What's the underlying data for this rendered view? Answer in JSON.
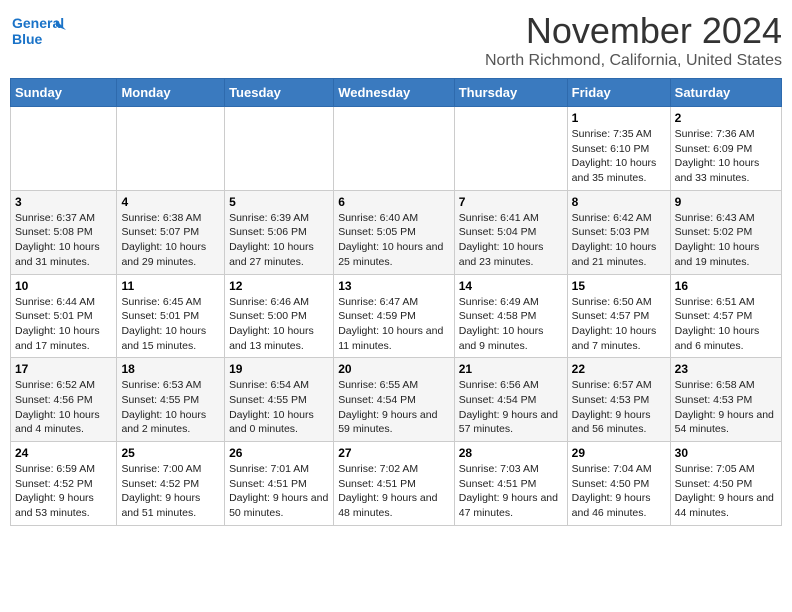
{
  "header": {
    "logo_line1": "General",
    "logo_line2": "Blue",
    "month": "November 2024",
    "location": "North Richmond, California, United States"
  },
  "weekdays": [
    "Sunday",
    "Monday",
    "Tuesday",
    "Wednesday",
    "Thursday",
    "Friday",
    "Saturday"
  ],
  "weeks": [
    [
      {
        "day": "",
        "info": ""
      },
      {
        "day": "",
        "info": ""
      },
      {
        "day": "",
        "info": ""
      },
      {
        "day": "",
        "info": ""
      },
      {
        "day": "",
        "info": ""
      },
      {
        "day": "1",
        "info": "Sunrise: 7:35 AM\nSunset: 6:10 PM\nDaylight: 10 hours and 35 minutes."
      },
      {
        "day": "2",
        "info": "Sunrise: 7:36 AM\nSunset: 6:09 PM\nDaylight: 10 hours and 33 minutes."
      }
    ],
    [
      {
        "day": "3",
        "info": "Sunrise: 6:37 AM\nSunset: 5:08 PM\nDaylight: 10 hours and 31 minutes."
      },
      {
        "day": "4",
        "info": "Sunrise: 6:38 AM\nSunset: 5:07 PM\nDaylight: 10 hours and 29 minutes."
      },
      {
        "day": "5",
        "info": "Sunrise: 6:39 AM\nSunset: 5:06 PM\nDaylight: 10 hours and 27 minutes."
      },
      {
        "day": "6",
        "info": "Sunrise: 6:40 AM\nSunset: 5:05 PM\nDaylight: 10 hours and 25 minutes."
      },
      {
        "day": "7",
        "info": "Sunrise: 6:41 AM\nSunset: 5:04 PM\nDaylight: 10 hours and 23 minutes."
      },
      {
        "day": "8",
        "info": "Sunrise: 6:42 AM\nSunset: 5:03 PM\nDaylight: 10 hours and 21 minutes."
      },
      {
        "day": "9",
        "info": "Sunrise: 6:43 AM\nSunset: 5:02 PM\nDaylight: 10 hours and 19 minutes."
      }
    ],
    [
      {
        "day": "10",
        "info": "Sunrise: 6:44 AM\nSunset: 5:01 PM\nDaylight: 10 hours and 17 minutes."
      },
      {
        "day": "11",
        "info": "Sunrise: 6:45 AM\nSunset: 5:01 PM\nDaylight: 10 hours and 15 minutes."
      },
      {
        "day": "12",
        "info": "Sunrise: 6:46 AM\nSunset: 5:00 PM\nDaylight: 10 hours and 13 minutes."
      },
      {
        "day": "13",
        "info": "Sunrise: 6:47 AM\nSunset: 4:59 PM\nDaylight: 10 hours and 11 minutes."
      },
      {
        "day": "14",
        "info": "Sunrise: 6:49 AM\nSunset: 4:58 PM\nDaylight: 10 hours and 9 minutes."
      },
      {
        "day": "15",
        "info": "Sunrise: 6:50 AM\nSunset: 4:57 PM\nDaylight: 10 hours and 7 minutes."
      },
      {
        "day": "16",
        "info": "Sunrise: 6:51 AM\nSunset: 4:57 PM\nDaylight: 10 hours and 6 minutes."
      }
    ],
    [
      {
        "day": "17",
        "info": "Sunrise: 6:52 AM\nSunset: 4:56 PM\nDaylight: 10 hours and 4 minutes."
      },
      {
        "day": "18",
        "info": "Sunrise: 6:53 AM\nSunset: 4:55 PM\nDaylight: 10 hours and 2 minutes."
      },
      {
        "day": "19",
        "info": "Sunrise: 6:54 AM\nSunset: 4:55 PM\nDaylight: 10 hours and 0 minutes."
      },
      {
        "day": "20",
        "info": "Sunrise: 6:55 AM\nSunset: 4:54 PM\nDaylight: 9 hours and 59 minutes."
      },
      {
        "day": "21",
        "info": "Sunrise: 6:56 AM\nSunset: 4:54 PM\nDaylight: 9 hours and 57 minutes."
      },
      {
        "day": "22",
        "info": "Sunrise: 6:57 AM\nSunset: 4:53 PM\nDaylight: 9 hours and 56 minutes."
      },
      {
        "day": "23",
        "info": "Sunrise: 6:58 AM\nSunset: 4:53 PM\nDaylight: 9 hours and 54 minutes."
      }
    ],
    [
      {
        "day": "24",
        "info": "Sunrise: 6:59 AM\nSunset: 4:52 PM\nDaylight: 9 hours and 53 minutes."
      },
      {
        "day": "25",
        "info": "Sunrise: 7:00 AM\nSunset: 4:52 PM\nDaylight: 9 hours and 51 minutes."
      },
      {
        "day": "26",
        "info": "Sunrise: 7:01 AM\nSunset: 4:51 PM\nDaylight: 9 hours and 50 minutes."
      },
      {
        "day": "27",
        "info": "Sunrise: 7:02 AM\nSunset: 4:51 PM\nDaylight: 9 hours and 48 minutes."
      },
      {
        "day": "28",
        "info": "Sunrise: 7:03 AM\nSunset: 4:51 PM\nDaylight: 9 hours and 47 minutes."
      },
      {
        "day": "29",
        "info": "Sunrise: 7:04 AM\nSunset: 4:50 PM\nDaylight: 9 hours and 46 minutes."
      },
      {
        "day": "30",
        "info": "Sunrise: 7:05 AM\nSunset: 4:50 PM\nDaylight: 9 hours and 44 minutes."
      }
    ]
  ]
}
